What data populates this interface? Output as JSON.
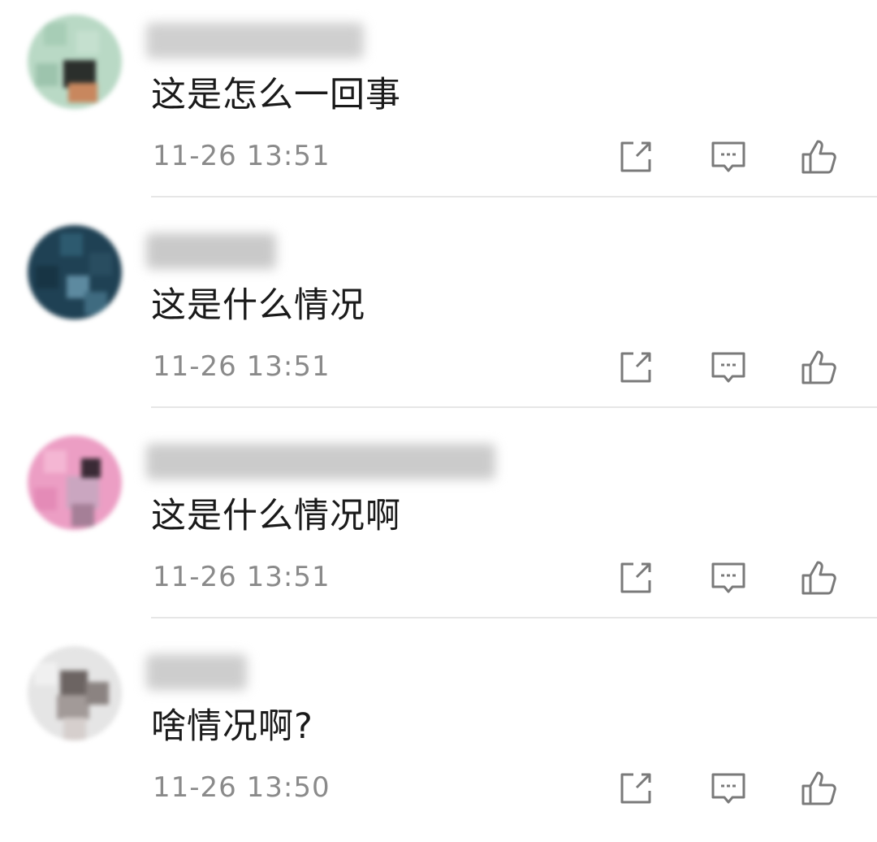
{
  "comments": [
    {
      "avatar_colors": [
        "#b9d9c5",
        "#a7cdb6",
        "#c5e0cf",
        "#2b2f2c",
        "#c8875e",
        "#9dc4ad"
      ],
      "text": "这是怎么一回事",
      "time": "11-26 13:51"
    },
    {
      "avatar_colors": [
        "#1f4154",
        "#2d5a6f",
        "#173444",
        "#5d8aa0",
        "#294d60",
        "#3f6b80"
      ],
      "text": "这是什么情况",
      "time": "11-26 13:51"
    },
    {
      "avatar_colors": [
        "#ec9ec4",
        "#f4b6d3",
        "#caa6c0",
        "#3a2a35",
        "#a57f97",
        "#e48bb7"
      ],
      "text": "这是什么情况啊",
      "time": "11-26 13:51"
    },
    {
      "avatar_colors": [
        "#e5e5e5",
        "#6c6462",
        "#a29a98",
        "#d6cfcd",
        "#8b8381",
        "#f0f0f0"
      ],
      "text": "啥情况啊?",
      "time": "11-26 13:50"
    }
  ],
  "actions": {
    "repost_icon": "share-square-icon",
    "reply_icon": "comment-bubble-icon",
    "like_icon": "thumbs-up-icon",
    "icon_color": "#7a7a7a"
  }
}
